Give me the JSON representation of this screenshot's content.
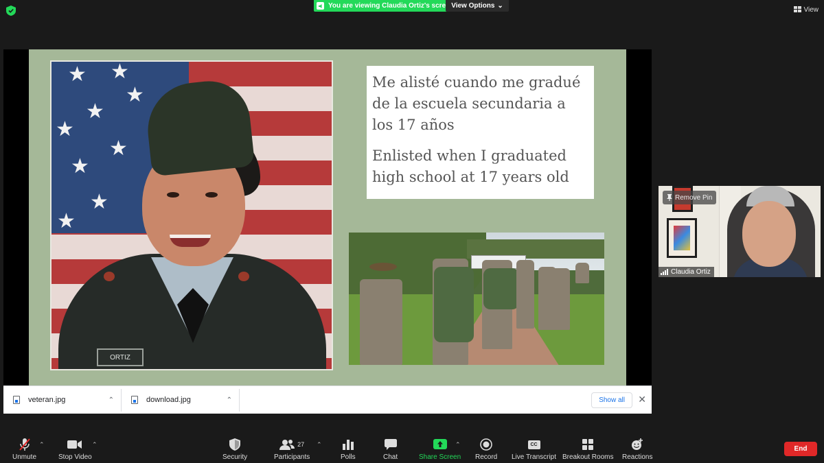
{
  "top_bar": {
    "banner_text": "You are viewing Claudia Ortiz's screen",
    "view_options_label": "View Options",
    "view_label": "View"
  },
  "slide": {
    "spanish_text": "Me alisté cuando me gradué de la escuela secundaria a los 17 años",
    "english_text": "Enlisted when I graduated high school at 17 years old",
    "nameplate": "ORTIZ"
  },
  "video_tile": {
    "remove_pin_label": "Remove Pin",
    "participant_name": "Claudia Ortiz"
  },
  "downloads": {
    "items": [
      {
        "name": "veteran.jpg"
      },
      {
        "name": "download.jpg"
      }
    ],
    "show_all_label": "Show all"
  },
  "toolbar": {
    "unmute": "Unmute",
    "stop_video": "Stop Video",
    "security": "Security",
    "participants": "Participants",
    "participants_count": "27",
    "polls": "Polls",
    "chat": "Chat",
    "share_screen": "Share Screen",
    "record": "Record",
    "live_transcript": "Live Transcript",
    "breakout_rooms": "Breakout Rooms",
    "reactions": "Reactions",
    "end": "End"
  },
  "colors": {
    "accent_green": "#23d959",
    "end_red": "#e02828",
    "slide_background": "#a5b898"
  }
}
